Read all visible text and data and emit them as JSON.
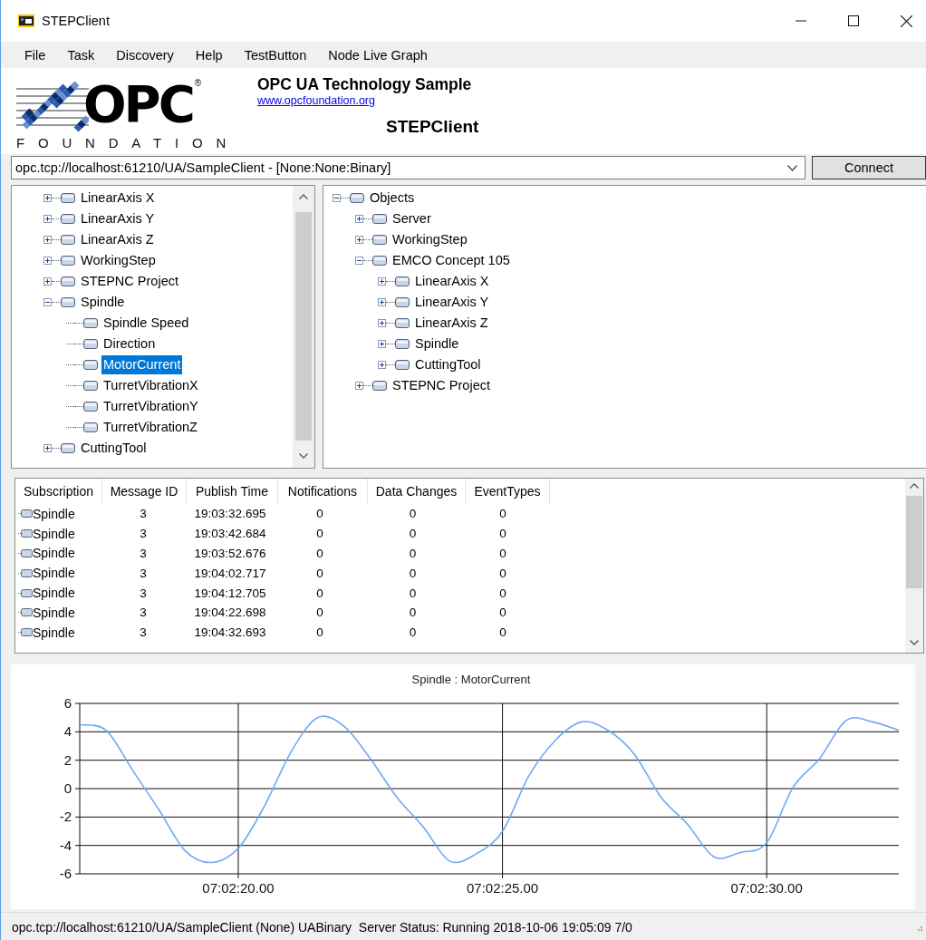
{
  "window": {
    "title": "STEPClient"
  },
  "menu": [
    "File",
    "Task",
    "Discovery",
    "Help",
    "TestButton",
    "Node Live Graph"
  ],
  "header": {
    "logo": {
      "mark": "OPC",
      "registered": "®",
      "wordmark": "FOUNDATION"
    },
    "title": "OPC UA Technology Sample",
    "link": "www.opcfoundation.org",
    "app_name": "STEPClient"
  },
  "endpoint": {
    "value": "opc.tcp://localhost:61210/UA/SampleClient - [None:None:Binary]",
    "button": "Connect"
  },
  "left_tree": {
    "items": [
      {
        "label": "LinearAxis X",
        "expanded": false,
        "selected": false
      },
      {
        "label": "LinearAxis Y",
        "expanded": false,
        "selected": false
      },
      {
        "label": "LinearAxis Z",
        "expanded": false,
        "selected": false
      },
      {
        "label": "WorkingStep",
        "expanded": false,
        "selected": false
      },
      {
        "label": "STEPNC Project",
        "expanded": false,
        "selected": false
      },
      {
        "label": "Spindle",
        "expanded": true,
        "selected": false,
        "children": [
          {
            "label": "Spindle Speed",
            "selected": false
          },
          {
            "label": "Direction",
            "selected": false
          },
          {
            "label": "MotorCurrent",
            "selected": true
          },
          {
            "label": "TurretVibrationX",
            "selected": false
          },
          {
            "label": "TurretVibrationY",
            "selected": false
          },
          {
            "label": "TurretVibrationZ",
            "selected": false
          }
        ]
      },
      {
        "label": "CuttingTool",
        "expanded": false,
        "selected": false
      }
    ]
  },
  "right_tree": {
    "items": [
      {
        "label": "Objects",
        "expanded": true,
        "selected": false,
        "children": [
          {
            "label": "Server",
            "expanded": false,
            "selected": false
          },
          {
            "label": "WorkingStep",
            "expanded": false,
            "selected": false
          },
          {
            "label": "EMCO Concept 105",
            "expanded": true,
            "selected": false,
            "children": [
              {
                "label": "LinearAxis X",
                "expanded": false,
                "selected": false
              },
              {
                "label": "LinearAxis Y",
                "expanded": false,
                "selected": false
              },
              {
                "label": "LinearAxis Z",
                "expanded": false,
                "selected": false
              },
              {
                "label": "Spindle",
                "expanded": false,
                "selected": false
              },
              {
                "label": "CuttingTool",
                "expanded": false,
                "selected": false
              }
            ]
          },
          {
            "label": "STEPNC Project",
            "expanded": false,
            "selected": false
          }
        ]
      }
    ]
  },
  "subscription_table": {
    "columns": [
      "Subscription",
      "Message ID",
      "Publish Time",
      "Notifications",
      "Data Changes",
      "EventTypes"
    ],
    "rows": [
      [
        "Spindle",
        "3",
        "19:03:32.695",
        "0",
        "0",
        "0"
      ],
      [
        "Spindle",
        "3",
        "19:03:42.684",
        "0",
        "0",
        "0"
      ],
      [
        "Spindle",
        "3",
        "19:03:52.676",
        "0",
        "0",
        "0"
      ],
      [
        "Spindle",
        "3",
        "19:04:02.717",
        "0",
        "0",
        "0"
      ],
      [
        "Spindle",
        "3",
        "19:04:12.705",
        "0",
        "0",
        "0"
      ],
      [
        "Spindle",
        "3",
        "19:04:22.698",
        "0",
        "0",
        "0"
      ],
      [
        "Spindle",
        "3",
        "19:04:32.693",
        "0",
        "0",
        "0"
      ]
    ]
  },
  "graph": {
    "chart_data": {
      "type": "line",
      "title": "Spindle : MotorCurrent",
      "categories": [
        null,
        null,
        null,
        null,
        null,
        null,
        "07:02:20.00",
        null,
        null,
        null,
        null,
        null,
        null,
        null,
        null,
        null,
        "07:02:25.00",
        null,
        null,
        null,
        null,
        null,
        null,
        null,
        null,
        null,
        "07:02:30.00",
        null,
        null,
        null,
        null,
        null
      ],
      "series": [
        {
          "color": "#6fa8f5",
          "values": [
            4.5,
            4.1,
            1.3,
            -1.5,
            -4.4,
            -5.2,
            -4.2,
            -1.2,
            2.6,
            5.0,
            4.4,
            2.1,
            -0.6,
            -2.7,
            -5.1,
            -4.6,
            -3.0,
            0.9,
            3.4,
            4.7,
            4.1,
            2.4,
            -0.6,
            -2.5,
            -4.8,
            -4.5,
            -3.8,
            0.1,
            2.1,
            4.8,
            4.7,
            4.1
          ]
        }
      ],
      "ylim": [
        -6,
        6
      ],
      "grid": true,
      "yticks": [
        -6,
        -4,
        -2,
        0,
        2,
        4,
        6
      ]
    }
  },
  "status_bar": {
    "text": "opc.tcp://localhost:61210/UA/SampleClient (None) UABinary  Server Status: Running 2018-10-06 19:05:09 7/0"
  }
}
